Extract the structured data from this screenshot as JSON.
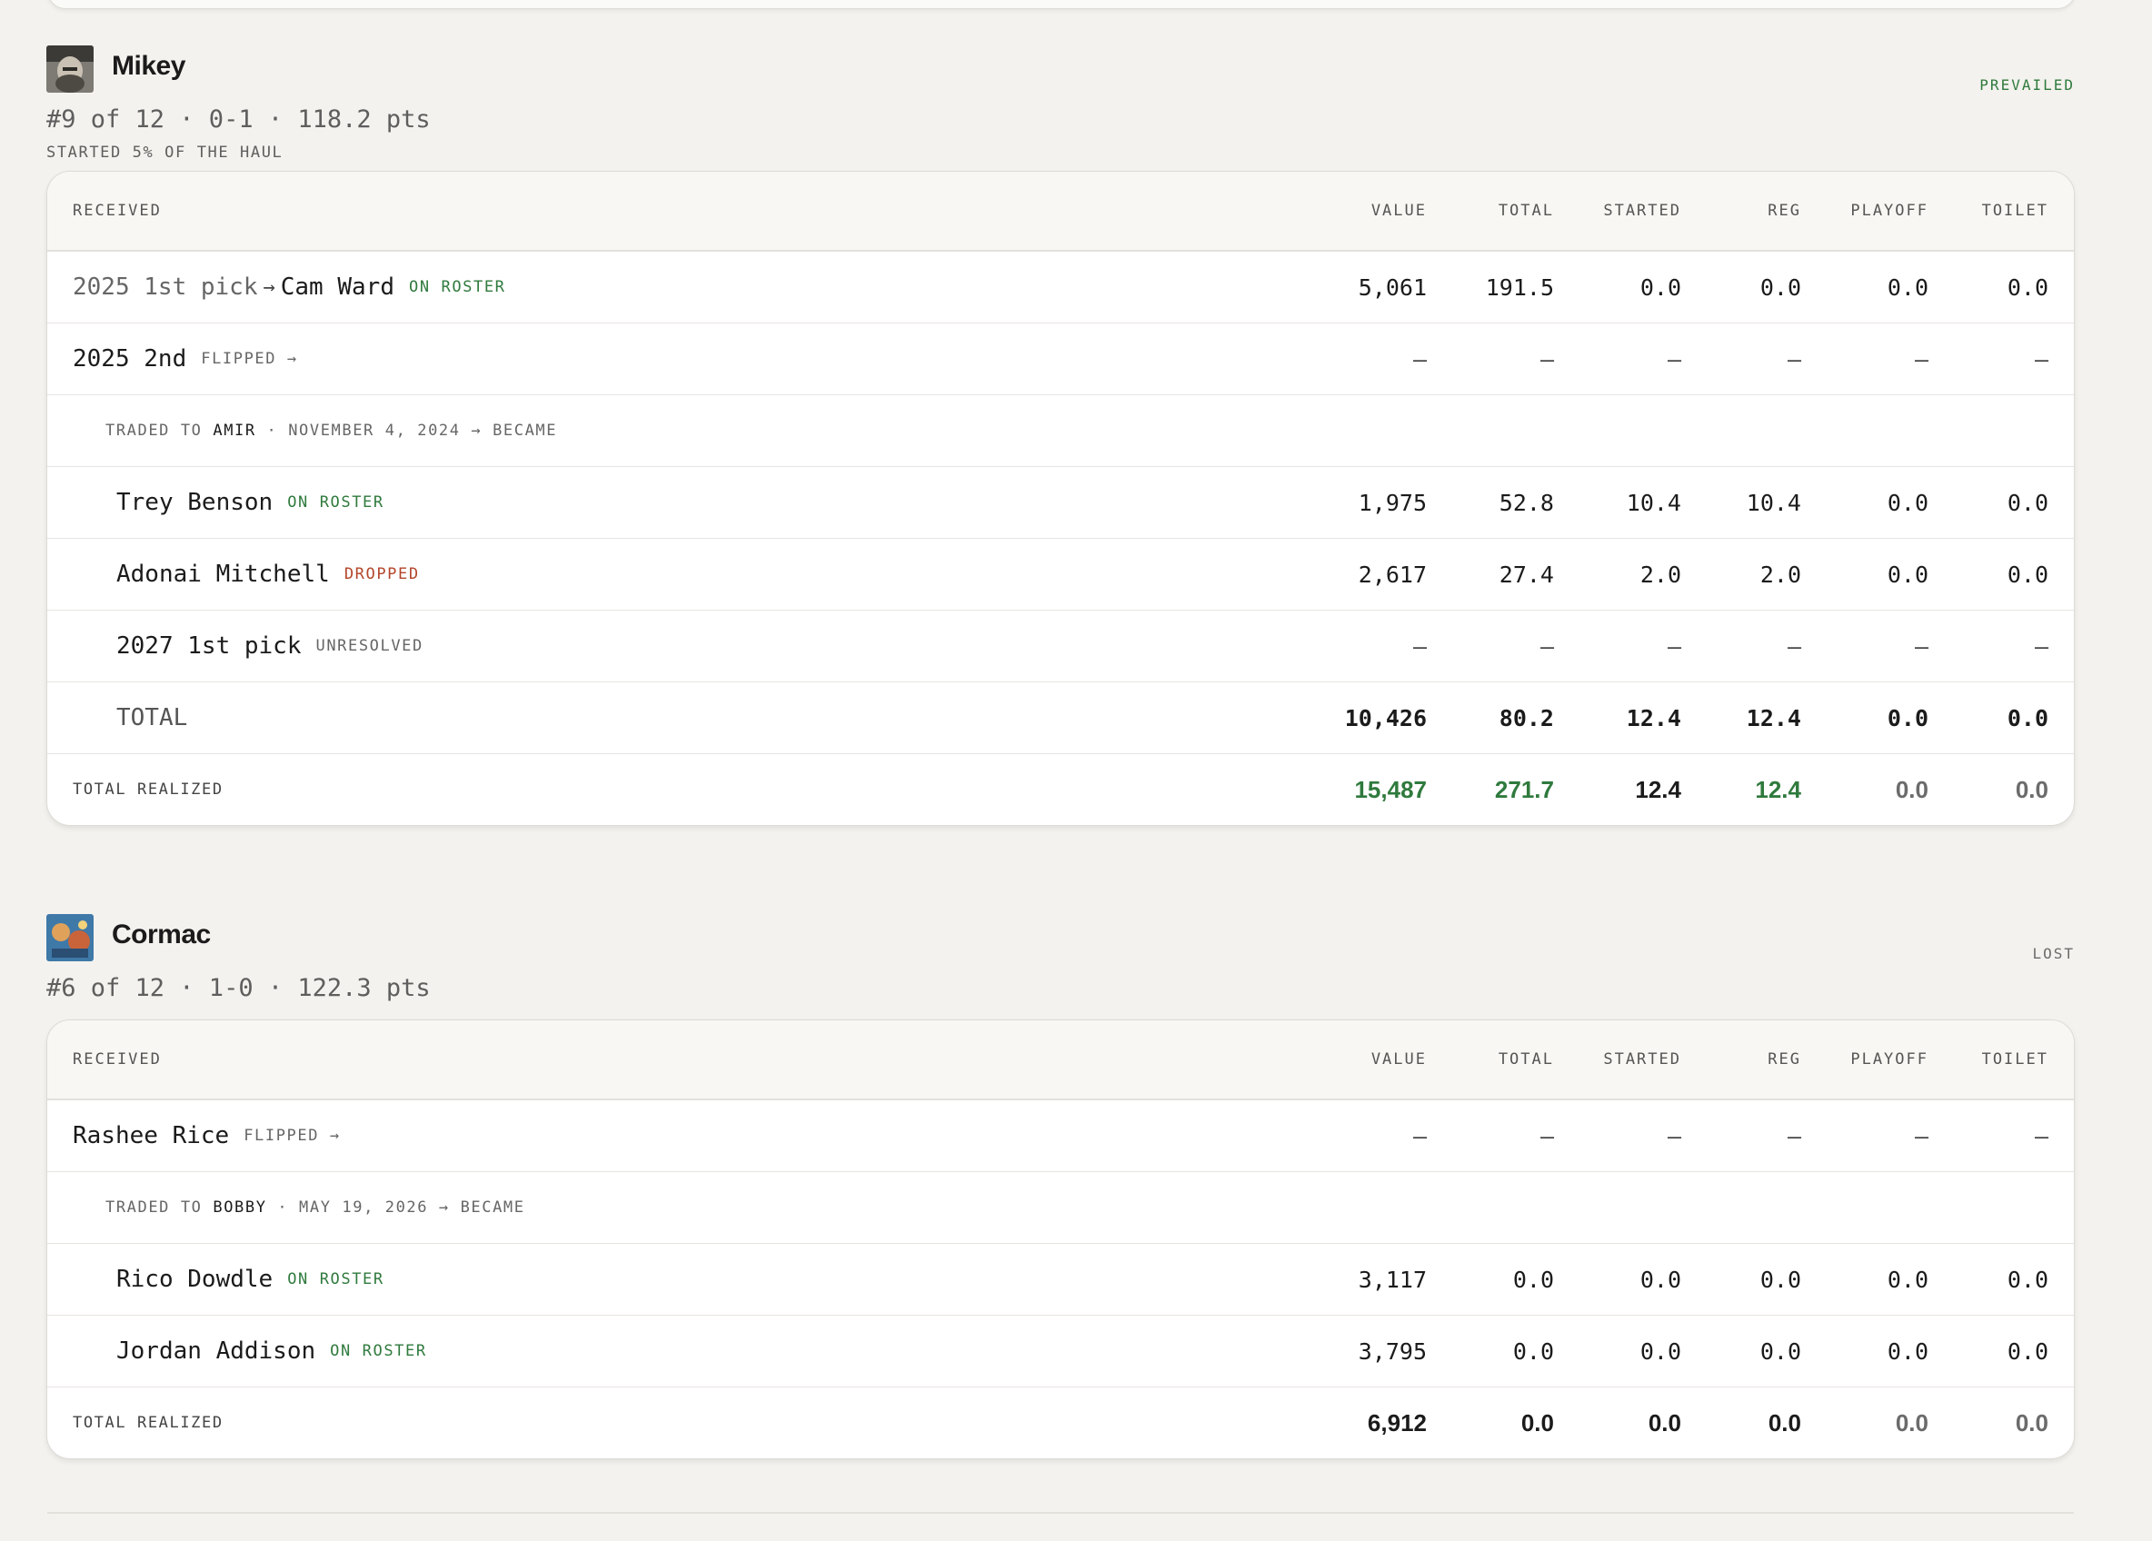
{
  "columns": [
    "RECEIVED",
    "VALUE",
    "TOTAL",
    "STARTED",
    "REG",
    "PLAYOFF",
    "TOILET"
  ],
  "teams": [
    {
      "name": "Mikey",
      "result": "PREVAILED",
      "meta": "#9 of 12 · 0-1 · 118.2 pts",
      "sub_meta": "STARTED 5% OF THE HAUL",
      "rows": [
        {
          "kind": "pick",
          "pick": "2025 1st pick",
          "arrow": "→",
          "player": "Cam Ward",
          "tag": "ON ROSTER",
          "values": [
            "5,061",
            "191.5",
            "0.0",
            "0.0",
            "0.0",
            "0.0"
          ]
        },
        {
          "kind": "flipped",
          "name": "2025 2nd",
          "tag": "FLIPPED →",
          "values": [
            "–",
            "–",
            "–",
            "–",
            "–",
            "–"
          ]
        },
        {
          "kind": "note",
          "prefix": "TRADED TO",
          "to": "AMIR",
          "suffix": "· NOVEMBER 4, 2024 → BECAME"
        },
        {
          "kind": "sub",
          "name": "Trey Benson",
          "tag": "ON ROSTER",
          "tag_color": "green",
          "values": [
            "1,975",
            "52.8",
            "10.4",
            "10.4",
            "0.0",
            "0.0"
          ]
        },
        {
          "kind": "sub",
          "name": "Adonai Mitchell",
          "tag": "DROPPED",
          "tag_color": "red",
          "values": [
            "2,617",
            "27.4",
            "2.0",
            "2.0",
            "0.0",
            "0.0"
          ]
        },
        {
          "kind": "sub",
          "name": "2027 1st pick",
          "tag": "UNRESOLVED",
          "tag_color": "gray",
          "values": [
            "–",
            "–",
            "–",
            "–",
            "–",
            "–"
          ]
        },
        {
          "kind": "total",
          "label": "TOTAL",
          "values": [
            "10,426",
            "80.2",
            "12.4",
            "12.4",
            "0.0",
            "0.0"
          ]
        }
      ],
      "realized": {
        "label": "TOTAL REALIZED",
        "values": [
          "15,487",
          "271.7",
          "12.4",
          "12.4",
          "0.0",
          "0.0"
        ],
        "colors": [
          "#2f7a3d",
          "#2f7a3d",
          "#1b1b1b",
          "#2f7a3d",
          "#6b6b6b",
          "#6b6b6b"
        ]
      }
    },
    {
      "name": "Cormac",
      "result": "LOST",
      "meta": "#6 of 12 · 1-0 · 122.3 pts",
      "rows": [
        {
          "kind": "flipped",
          "name": "Rashee Rice",
          "tag": "FLIPPED →",
          "values": [
            "–",
            "–",
            "–",
            "–",
            "–",
            "–"
          ]
        },
        {
          "kind": "note",
          "prefix": "TRADED TO",
          "to": "BOBBY",
          "suffix": "· MAY 19, 2026 → BECAME"
        },
        {
          "kind": "sub",
          "name": "Rico Dowdle",
          "tag": "ON ROSTER",
          "tag_color": "green",
          "values": [
            "3,117",
            "0.0",
            "0.0",
            "0.0",
            "0.0",
            "0.0"
          ]
        },
        {
          "kind": "sub",
          "name": "Jordan Addison",
          "tag": "ON ROSTER",
          "tag_color": "green",
          "values": [
            "3,795",
            "0.0",
            "0.0",
            "0.0",
            "0.0",
            "0.0"
          ]
        }
      ],
      "realized": {
        "label": "TOTAL REALIZED",
        "values": [
          "6,912",
          "0.0",
          "0.0",
          "0.0",
          "0.0",
          "0.0"
        ],
        "colors": [
          "#1b1b1b",
          "#1b1b1b",
          "#1b1b1b",
          "#1b1b1b",
          "#6b6b6b",
          "#6b6b6b"
        ]
      }
    }
  ]
}
